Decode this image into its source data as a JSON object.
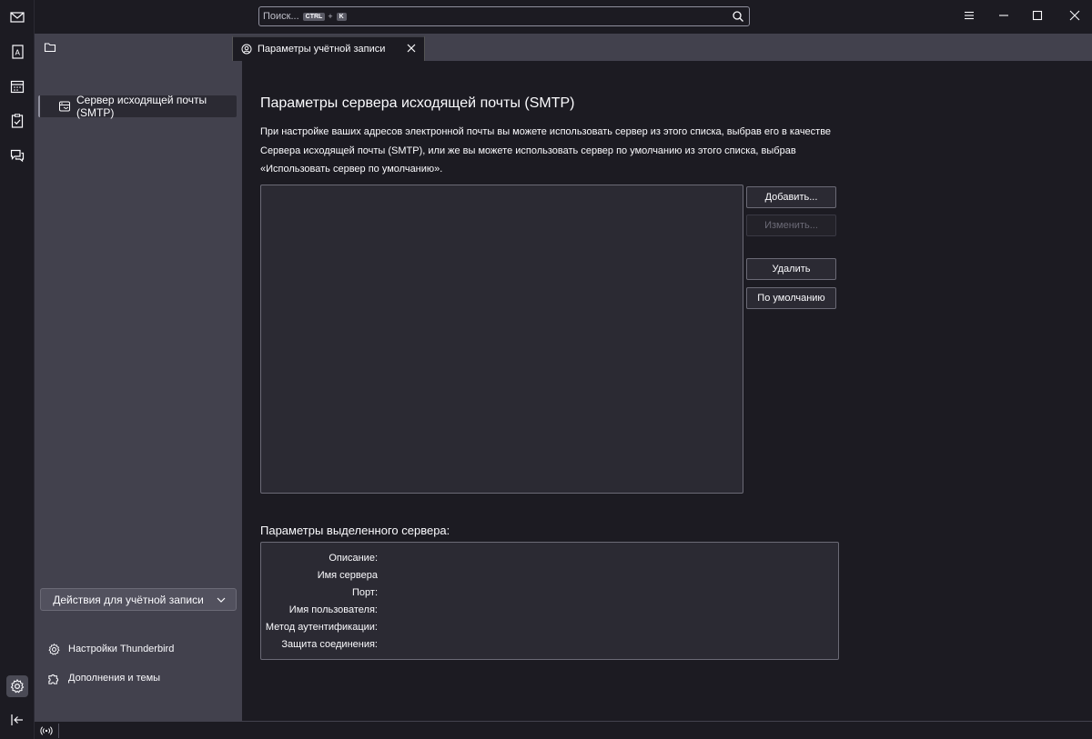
{
  "search": {
    "placeholder": "Поиск...",
    "shortcut_mod": "CTRL",
    "shortcut_plus": "+",
    "shortcut_key": "K"
  },
  "tab": {
    "label": "Параметры учётной записи"
  },
  "sidebar": {
    "items": [
      {
        "label": "Сервер исходящей почты (SMTP)"
      }
    ],
    "account_actions": "Действия для учётной записи",
    "settings_link": "Настройки Thunderbird",
    "addons_link": "Дополнения и темы"
  },
  "main": {
    "title": "Параметры сервера исходящей почты (SMTP)",
    "description": "При настройке ваших адресов электронной почты вы можете использовать сервер из этого списка, выбрав его в качестве Сервера исходящей почты (SMTP), или же вы можете использовать сервер по умолчанию из этого списка, выбрав «Использовать сервер по умолчанию».",
    "buttons": {
      "add": "Добавить...",
      "edit": "Изменить...",
      "remove": "Удалить",
      "set_default": "По умолчанию"
    },
    "details_title": "Параметры выделенного сервера:",
    "details": {
      "description_label": "Описание:",
      "server_name_label": "Имя сервера",
      "port_label": "Порт:",
      "username_label": "Имя пользователя:",
      "auth_method_label": "Метод аутентификации:",
      "security_label": "Защита соединения:"
    }
  },
  "colors": {
    "background": "#1c1b22",
    "sidebar": "#42414d",
    "panel": "#2b2a33",
    "border": "#6b6a76",
    "text": "#fbfbfe"
  }
}
